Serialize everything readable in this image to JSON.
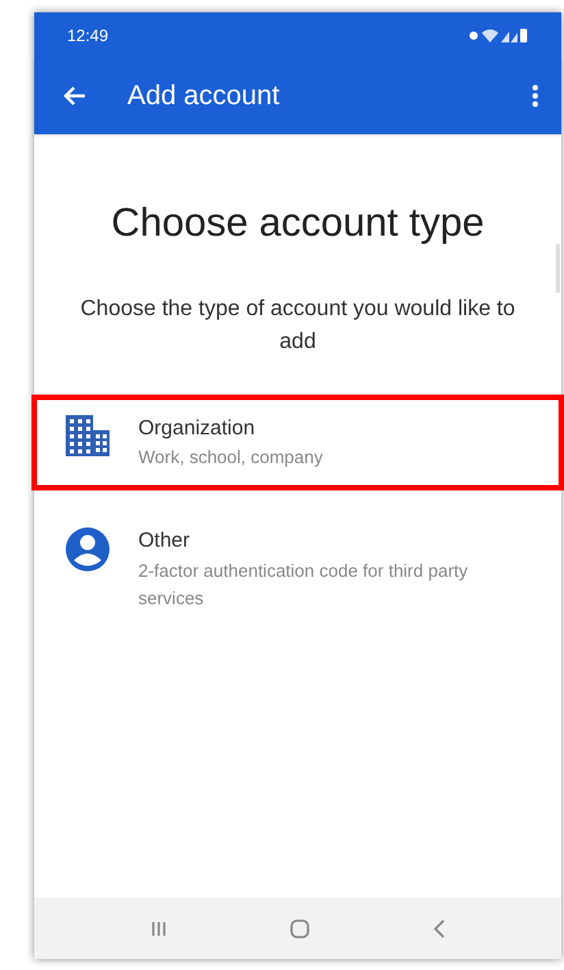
{
  "status_bar": {
    "time": "12:49"
  },
  "app_bar": {
    "title": "Add account"
  },
  "heading": "Choose account type",
  "subtitle": "Choose the type of account you would like to add",
  "options": [
    {
      "kind": "building",
      "title": "Organization",
      "description": "Work, school, company",
      "highlighted": true
    },
    {
      "kind": "person",
      "title": "Other",
      "description": "2-factor authentication code for third party services",
      "highlighted": false
    }
  ]
}
